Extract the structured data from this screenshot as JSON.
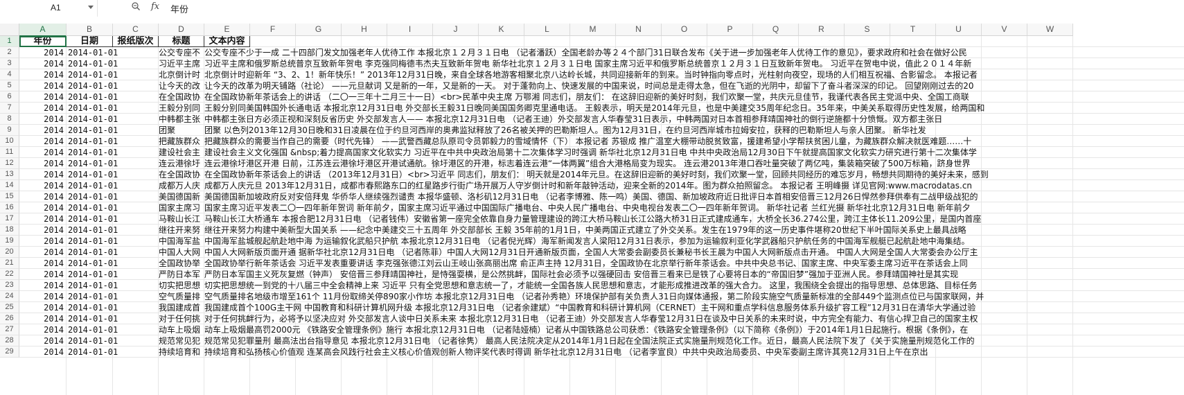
{
  "formula_bar": {
    "cell_ref": "A1",
    "zoom_icon": "zoom-search-icon",
    "fx_label": "fx",
    "content": "年份"
  },
  "columns": [
    "A",
    "B",
    "C",
    "D",
    "E",
    "F",
    "G",
    "H",
    "I",
    "J",
    "K",
    "L",
    "M",
    "N",
    "O",
    "P",
    "Q",
    "R",
    "S",
    "T",
    "U",
    "V",
    "W"
  ],
  "selected_column": "A",
  "header_row": [
    "年份",
    "日期",
    "报纸版次",
    "标题",
    "文本内容"
  ],
  "rows": [
    {
      "n": "2",
      "year": "2014",
      "date": "2014-01-01",
      "title": "公交专座不",
      "content": "公交专座不少于一成 二十四部门发文加强老年人优待工作 本报北京１２月３１日电 （记者潘跃）全国老龄办等２４个部门31日联合发布《关于进一步加强老年人优待工作的意见》，要求政府和社会在做好公民"
    },
    {
      "n": "3",
      "year": "2014",
      "date": "2014-01-01",
      "title": "习近平主席",
      "content": "习近平主席和俄罗斯总统普京互致新年贺电 李克强同梅德韦杰夫互致新年贺电 新华社北京１２月３１日电 国家主席习近平和俄罗斯总统普京１２月３１日互致新年贺电。 习近平在贺电中说，值此２０１４年新"
    },
    {
      "n": "4",
      "year": "2014",
      "date": "2014-01-01",
      "title": "北京倒计时",
      "content": "北京倒计时迎新年 “3、2、1！新年快乐！” 2013年12月31日晚，来自全球各地游客相聚北京八达岭长城，共同迎接新年的到来。当时钟指向零点时，光柱射向夜空，现场的人们相互祝福、合影留念。 本报记者"
    },
    {
      "n": "5",
      "year": "2014",
      "date": "2014-01-01",
      "title": "让今天的改",
      "content": "让今天的改革为明天铺路（社论） ——元旦献词 又是新的一年，又是新的一天。 对于蓬勃向上、快速发展的中国来说，时间总是走得太急，但在飞逝的光阴中，却留下了奋斗者深深的印记。 回望刚刚过去的20"
    },
    {
      "n": "6",
      "year": "2014",
      "date": "2014-01-01",
      "title": "在全国政协",
      "content": "在全国政协新年茶话会上的讲话 （二〇一三年十二月三十一日）<br>民革中央主席 万鄂湘 同志们，朋友们： 在这辞旧迎新的美好时刻，我们欢聚一堂，共庆元旦佳节，我谨代表各民主党派中央、全国工商联"
    },
    {
      "n": "7",
      "year": "2014",
      "date": "2014-01-01",
      "title": "王毅分别同",
      "content": "王毅分别同美国韩国外长通电话 本报北京12月31日电 外交部长王毅31日晚同美国国务卿克里通电话。 王毅表示，明天是2014年元旦，也是中美建交35周年纪念日。35年来，中美关系取得历史性发展，给两国和"
    },
    {
      "n": "8",
      "year": "2014",
      "date": "2014-01-01",
      "title": "中韩都主张",
      "content": "中韩都主张日方必须正视和深刻反省历史 外交部发言人—— 本报北京12月31日电 （记者王迪）外交部发言人华春莹31日表示，中韩两国对日本首相参拜靖国神社的倒行逆施都十分愤慨。双方都主张日"
    },
    {
      "n": "9",
      "year": "2014",
      "date": "2014-01-01",
      "title": "团聚",
      "content": "团聚 以色列2013年12月30日晚和31日凌晨在位于约旦河西岸的奥弗监狱释放了26名被关押的巴勒斯坦人。图为12月31日，在约旦河西岸城市拉姆安拉，获释的巴勒斯坦人与亲人团聚。 新华社发"
    },
    {
      "n": "10",
      "year": "2014",
      "date": "2014-01-01",
      "title": "把藏族群众",
      "content": "把藏族群众的需要当作自己的需要（时代先锋） ——武警西藏总队原司令员郭毅力的雪域情怀（下） 本报记者 苏银成 推广温室大棚带动脱贫致富，援建希望小学帮扶贫困儿童，为藏族群众解决就医难题……十"
    },
    {
      "n": "11",
      "year": "2014",
      "date": "2014-01-01",
      "title": "建设社会主",
      "content": "建设社会主义文化强国 &nbsp;着力提高国家文化软实力 习近平在中共中央政治局第十二次集体学习时强调 新华社北京12月31日电 中共中央政治局12月30日下午就提高国家文化软实力研究进行第十二次集体学"
    },
    {
      "n": "12",
      "year": "2014",
      "date": "2014-01-01",
      "title": "连云港徐圩",
      "content": "连云港徐圩港区开港 日前，江苏连云港徐圩港区开港试通航。徐圩港区的开港，标志着连云港“一体两翼”组合大港格局变为现实。 连云港2013年港口吞吐量突破了两亿吨，集装箱突破了500万标箱，跻身世界"
    },
    {
      "n": "13",
      "year": "2014",
      "date": "2014-01-01",
      "title": "在全国政协",
      "content": "在全国政协新年茶话会上的讲话 （2013年12月31日）<br>习近平 同志们，朋友们： 明天就是2014年元旦。在这辞旧迎新的美好时刻，我们欢聚一堂，回顾共同经历的难忘岁月，畅想共同期待的美好未来，感到"
    },
    {
      "n": "14",
      "year": "2014",
      "date": "2014-01-01",
      "title": "成都万人庆",
      "content": "成都万人庆元旦 2013年12月31日，成都市春熙路东口的红星路步行街广场开展万人守岁倒计时和新年敲钟活动，迎来全新的2014年。图为群众拍照留念。 本报记者 王明峰摄 详见官网:www.macrodatas.cn"
    },
    {
      "n": "15",
      "year": "2014",
      "date": "2014-01-01",
      "title": "美国德国新",
      "content": "美国德国新加坡政府反对安倍拜鬼 华侨华人继续强烈谴责 本报华盛顿、洛杉矶12月31日电 （记者李博雅、陈一鸣）美国、德国、新加坡政府近日批评日本首相安倍晋三12月26日悍然参拜供奉有二战甲级战犯的"
    },
    {
      "n": "16",
      "year": "2014",
      "date": "2014-01-01",
      "title": "国家主席习",
      "content": "国家主席习近平发表二〇一四年新年贺词 新年前夕，国家主席习近平通过中国国际广播电台、中央人民广播电台、中央电视台发表二〇一四年新年贺词。 新华社记者 兰红光摄 新华社北京12月31日电 新年前夕"
    },
    {
      "n": "17",
      "year": "2014",
      "date": "2014-01-01",
      "title": "马鞍山长江",
      "content": "马鞍山长江大桥通车 本报合肥12月31日电 （记者钱伟）安徽省第一座完全依靠自身力量管理建设的跨江大桥马鞍山长江公路大桥31日正式建成通车，大桥全长36.274公里，跨江主体长11.209公里，是国内首座"
    },
    {
      "n": "18",
      "year": "2014",
      "date": "2014-01-01",
      "title": "继往开来努",
      "content": "继往开来努力构建中美新型大国关系 ——纪念中美建交三十五周年 外交部部长 王毅 35年前的1月1日，中美两国正式建立了外交关系。发生在1979年的这一历史事件堪称20世纪下半叶国际关系史上最具战略"
    },
    {
      "n": "19",
      "year": "2014",
      "date": "2014-01-01",
      "title": "中国海军盐",
      "content": "中国海军盐城舰起航赴地中海 为运输叙化武船只护航 本报北京12月31日电 （记者倪光辉）海军新闻发言人梁阳12月31日表示，参加为运输叙利亚化学武器船只护航任务的中国海军舰艇已起航赴地中海集结。"
    },
    {
      "n": "20",
      "year": "2014",
      "date": "2014-01-01",
      "title": "中国人大网",
      "content": "中国人大网新版页面开通 据新华社北京12月31日电 （记者陈菲）中国人大网12月31日开通新版页面，全国人大常委会副委员长兼秘书长王晨为中国人大网新版点击开通。 中国人大网是全国人大常委会办公厅主"
    },
    {
      "n": "21",
      "year": "2014",
      "date": "2014-01-01",
      "title": "全国政协举",
      "content": "全国政协举行新年茶话会 习近平发表重要讲话 李克强张德江刘云山王岐山张高丽出席 俞正声主持 12月31日，全国政协在北京举行新年茶话会。中共中央总书记、国家主席、中央军委主席习近平在茶话会上同"
    },
    {
      "n": "22",
      "year": "2014",
      "date": "2014-01-01",
      "title": "严防日本军",
      "content": "严防日本军国主义死灰复燃（钟声） 安倍晋三参拜靖国神社，是恃强耍横，是公然挑衅，国际社会必须予以强硬回击 安倍晋三看来已是铁了心要将日本的“帝国旧梦”强加于亚洲人民。参拜靖国神社是其实现"
    },
    {
      "n": "23",
      "year": "2014",
      "date": "2014-01-01",
      "title": "切实把思想",
      "content": "切实把思想统一到党的十八届三中全会精神上来 习近平 只有全党思想和意志统一了，才能统一全国各族人民思想和意志，才能形成推进改革的强大合力。 这里，我围绕全会提出的指导思想、总体思路、目标任务"
    },
    {
      "n": "24",
      "year": "2014",
      "date": "2014-01-01",
      "title": "空气质量排",
      "content": "空气质量排名地级市增至161个 11月份取缔关停890家小作坊 本报北京12月31日电 （记者孙秀艳）环境保护部有关负责人31日向媒体通报，第二阶段实施空气质量新标准的全部449个监测点位已与国家联网，并"
    },
    {
      "n": "25",
      "year": "2014",
      "date": "2014-01-01",
      "title": "我国建成首",
      "content": "我国建成首个100G主干网 中国教育和科研计算机网升级 本报北京12月31日电 （记者余建斌）“中国教育和科研计算机网（CERNET）主干网和重点学科信息服务体系升级扩容工程”12月31日在清华大学通过验"
    },
    {
      "n": "26",
      "year": "2014",
      "date": "2014-01-01",
      "title": "对于任何挑",
      "content": "对于任何挑衅行为，必将予以坚决应对 外交部发言人谈中日关系未来 本报北京12月31日电 （记者王迪）外交部发言人华春莹12月31日在谈及中日关系的未来时说，中方完全有能力、有信心捍卫自己的国家主权"
    },
    {
      "n": "27",
      "year": "2014",
      "date": "2014-01-01",
      "title": "动车上吸烟",
      "content": "动车上吸烟最高罚2000元 《铁路安全管理条例》施行 本报北京12月31日电 （记者陆娅楠）记者从中国铁路总公司获悉：《铁路安全管理条例》（以下简称《条例》）于2014年1月1日起施行。根据《条例》，在"
    },
    {
      "n": "28",
      "year": "2014",
      "date": "2014-01-01",
      "title": "规范常见犯",
      "content": "规范常见犯罪量刑 最高法出台指导意见 本报北京12月31日电 （记者徐隽） 最高人民法院决定从2014年1月1日起在全国法院正式实施量刑规范化工作。近日，最高人民法院下发了《关于实施量刑规范化工作的"
    },
    {
      "n": "29",
      "year": "2014",
      "date": "2014-01-01",
      "title": "持续培育和",
      "content": "持续培育和弘扬核心价值观 连某高会风践行社会主义核心价值观创新人物评奖代表时得调 新华社北京12月31日电 （记者李宣良）中共中央政治局委员、中央军委副主席许其亮12月31日上午在京出"
    }
  ]
}
